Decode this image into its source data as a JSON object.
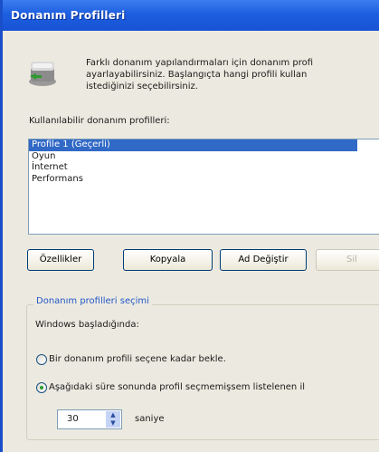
{
  "window": {
    "title": "Donanım Profilleri"
  },
  "description": [
    "Farklı donanım yapılandırmaları için donanım profi",
    "ayarlayabilirsiniz. Başlangıçta hangi profili kullan",
    "istediğinizi seçebilirsiniz."
  ],
  "profiles": {
    "label": "Kullanılabilir donanım profilleri:",
    "items": [
      "Profile 1 (Geçerli)",
      "Oyun",
      "İnternet",
      "Performans"
    ],
    "selected_index": 0
  },
  "buttons": {
    "properties": "Özellikler",
    "copy": "Kopyala",
    "rename": "Ad Değiştir",
    "delete": "Sil"
  },
  "selection_group": {
    "title": "Donanım profilleri seçimi",
    "startup_label": "Windows başladığında:",
    "radio_wait": "Bir donanım profili seçene kadar bekle.",
    "radio_timeout": "Aşağıdaki süre sonunda profil seçmemişsem listelenen il",
    "checked": "radio_timeout",
    "timeout_value": "30",
    "timeout_unit": "saniye"
  },
  "colors": {
    "title_bar": "#1d5fe0",
    "selection": "#3169c6",
    "group_title": "#2456c8"
  }
}
